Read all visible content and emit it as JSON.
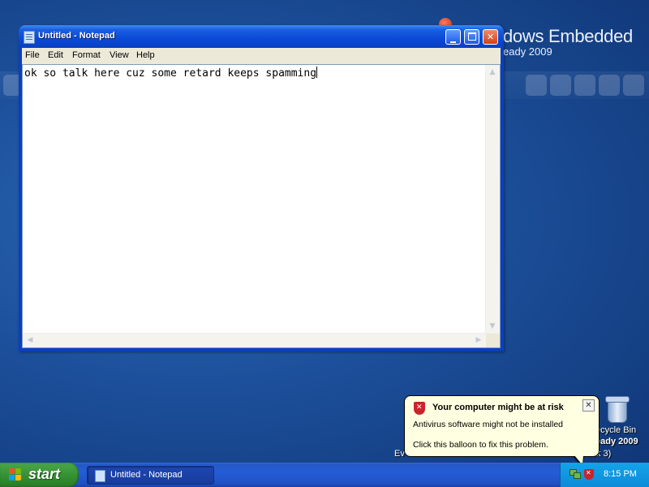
{
  "desktop": {
    "branding_title": "dows Embedded",
    "branding_subtitle": "eady 2009",
    "icons": [
      {
        "label": "ecycle Bin"
      }
    ],
    "watermark_line1": "eady 2009",
    "watermark_line2_prefix": "Ev",
    "watermark_line2_suffix": "ice Pack 3)"
  },
  "window": {
    "title": "Untitled - Notepad",
    "menu": [
      "File",
      "Edit",
      "Format",
      "View",
      "Help"
    ],
    "content": "ok so talk here cuz some retard keeps spamming"
  },
  "balloon": {
    "title": "Your computer might be at risk",
    "message": "Antivirus software might not be installed",
    "action": "Click this balloon to fix this problem."
  },
  "taskbar": {
    "start_label": "start",
    "task_label": "Untitled - Notepad",
    "clock": "8:15 PM"
  },
  "colors": {
    "desktop": "#1c4f9a",
    "titlebar": "#0a49d6",
    "start_button": "#3c9a3a",
    "tray": "#0d8bd8",
    "balloon": "#ffffe1",
    "alert": "#c8242c"
  }
}
